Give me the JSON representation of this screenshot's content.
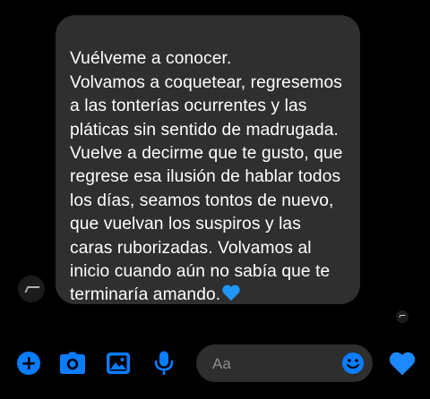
{
  "conversation": {
    "message_text": "Vuélveme a conocer.\nVolvamos a coquetear, regresemos a las tonterías ocurrentes y las pláticas sin sentido de madrugada. Vuelve a decirme que te gusto, que regrese esa ilusión de hablar todos los días, seamos tontos de nuevo, que vuelvan los suspiros y las caras ruborizadas. Volvamos al inicio cuando aún no sabía que te terminaría amando.",
    "message_emoji": "blue-heart-icon"
  },
  "composer": {
    "placeholder": "Aa"
  },
  "toolbar": {
    "icons": [
      "plus-icon",
      "camera-icon",
      "image-icon",
      "microphone-icon",
      "emoji-icon",
      "blue-heart-icon"
    ]
  },
  "colors": {
    "background": "#000000",
    "bubble": "#2f2f2f",
    "accent": "#0a7cff",
    "text": "#ffffff",
    "composer": "#2e2e2e"
  }
}
